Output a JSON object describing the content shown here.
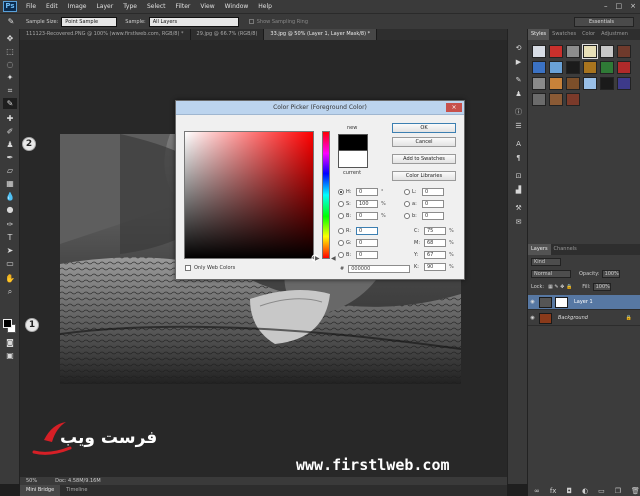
{
  "menubar": {
    "logo": "Ps",
    "items": [
      "File",
      "Edit",
      "Image",
      "Layer",
      "Type",
      "Select",
      "Filter",
      "View",
      "Window",
      "Help"
    ],
    "win_controls": [
      "–",
      "□",
      "×"
    ]
  },
  "options": {
    "sample_size_label": "Sample Size:",
    "sample_size_value": "Point Sample",
    "sample_label": "Sample:",
    "sample_value": "All Layers",
    "show_ring_label": "Show Sampling Ring",
    "workspace": "Essentials"
  },
  "doc_tabs": [
    "111123-Recovered.PNG @ 100% (www.firstlweb.com, RGB/8) *",
    "29.jpg @ 66.7% (RGB/8)",
    "33.jpg @ 50% (Layer 1, Layer Mask/8) *"
  ],
  "status": {
    "zoom": "50%",
    "doc": "Doc: 4.58M/9.16M"
  },
  "bottom_tabs": [
    "Mini Bridge",
    "Timeline"
  ],
  "watermark": {
    "brand": "فرست ويب",
    "url": "www.firstlweb.com"
  },
  "callouts": [
    "2",
    "1"
  ],
  "panels": {
    "tabs": [
      "Styles",
      "Swatches",
      "Color",
      "Adjustmen"
    ],
    "style_colors": [
      "#d8dde5",
      "#c9302c",
      "#8d8d8d",
      "#e8e0b8",
      "#c8c8c8",
      "#6f3a2c",
      "#3b72c4",
      "#6aa2d8",
      "#1b1b1b",
      "#a8741e",
      "#2f7a36",
      "#b02a2a",
      "#8a8a8a",
      "#c8823a",
      "#7c4f2a",
      "#9ac0e8",
      "#1a1a1a",
      "#3d3a8a",
      "#6b6b6b",
      "#8a5a35",
      "#7b3a2a"
    ],
    "layers_tabs": [
      "Layers",
      "Channels"
    ],
    "kind_label": "Kind",
    "blend_mode": "Normal",
    "opacity_label": "Opacity:",
    "opacity_value": "100%",
    "lock_label": "Lock:",
    "fill_label": "Fill:",
    "fill_value": "100%",
    "layers": [
      {
        "name": "Layer 1",
        "active": true
      },
      {
        "name": "Background",
        "active": false
      }
    ]
  },
  "color_picker": {
    "title": "Color Picker (Foreground Color)",
    "close": "×",
    "new_label": "new",
    "current_label": "current",
    "new_color": "#000000",
    "current_color": "#ffffff",
    "buttons": [
      "OK",
      "Cancel",
      "Add to Swatches",
      "Color Libraries"
    ],
    "only_web_label": "Only Web Colors",
    "hsb": [
      {
        "label": "H:",
        "value": "0",
        "unit": "°",
        "checked": true
      },
      {
        "label": "S:",
        "value": "100",
        "unit": "%",
        "checked": false
      },
      {
        "label": "B:",
        "value": "0",
        "unit": "%",
        "checked": false
      }
    ],
    "rgb": [
      {
        "label": "R:",
        "value": "0"
      },
      {
        "label": "G:",
        "value": "0"
      },
      {
        "label": "B:",
        "value": "0"
      }
    ],
    "lab": [
      {
        "label": "L:",
        "value": "0"
      },
      {
        "label": "a:",
        "value": "0"
      },
      {
        "label": "b:",
        "value": "0"
      }
    ],
    "cmyk": [
      {
        "label": "C:",
        "value": "75",
        "unit": "%"
      },
      {
        "label": "M:",
        "value": "68",
        "unit": "%"
      },
      {
        "label": "Y:",
        "value": "67",
        "unit": "%"
      },
      {
        "label": "K:",
        "value": "90",
        "unit": "%"
      }
    ],
    "hex_label": "#",
    "hex_value": "000000"
  }
}
